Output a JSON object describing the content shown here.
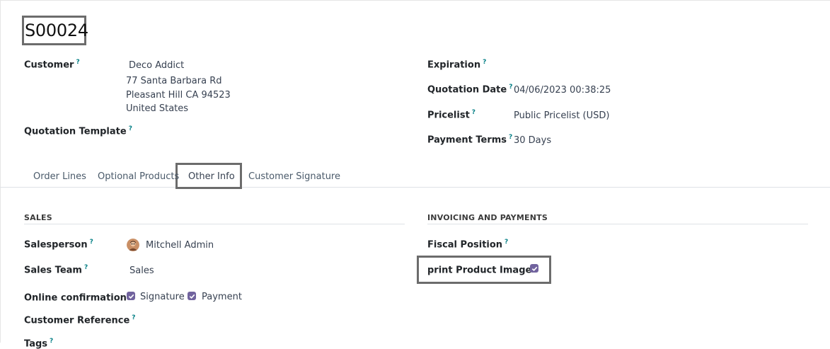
{
  "header": {
    "title": "S00024"
  },
  "left_fields": {
    "customer_label": "Customer",
    "customer_name": "Deco Addict",
    "address_line1": "77 Santa Barbara Rd",
    "address_line2": "Pleasant Hill CA 94523",
    "address_line3": "United States",
    "quotation_template_label": "Quotation Template"
  },
  "right_fields": {
    "expiration_label": "Expiration",
    "quotation_date_label": "Quotation Date",
    "quotation_date_value": "04/06/2023 00:38:25",
    "pricelist_label": "Pricelist",
    "pricelist_value": "Public Pricelist (USD)",
    "payment_terms_label": "Payment Terms",
    "payment_terms_value": "30 Days"
  },
  "help_marker": "?",
  "tabs": [
    {
      "label": "Order Lines"
    },
    {
      "label": "Optional Products"
    },
    {
      "label": "Other Info"
    },
    {
      "label": "Customer Signature"
    }
  ],
  "sales": {
    "section_title": "SALES",
    "salesperson_label": "Salesperson",
    "salesperson_value": "Mitchell Admin",
    "sales_team_label": "Sales Team",
    "sales_team_value": "Sales",
    "online_confirmation_label": "Online confirmation",
    "signature_label": "Signature",
    "payment_label": "Payment",
    "customer_reference_label": "Customer Reference",
    "partial_label": "Tags"
  },
  "invoicing": {
    "section_title": "INVOICING AND PAYMENTS",
    "fiscal_position_label": "Fiscal Position",
    "print_product_image_label": "print Product Image"
  },
  "colors": {
    "accent": "#71639e",
    "help": "#017e84"
  }
}
